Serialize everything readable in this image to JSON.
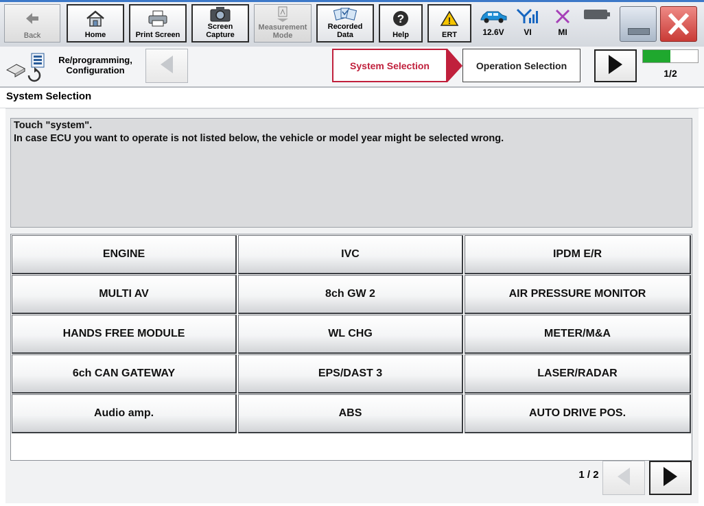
{
  "toolbar": {
    "back": "Back",
    "home": "Home",
    "print_screen": "Print Screen",
    "screen_capture_1": "Screen",
    "screen_capture_2": "Capture",
    "measurement_1": "Measurement",
    "measurement_2": "Mode",
    "recorded_1": "Recorded",
    "recorded_2": "Data",
    "help": "Help",
    "ert": "ERT"
  },
  "status": {
    "voltage": "12.6V",
    "vi": "VI",
    "mi": "MI"
  },
  "nav": {
    "mode_line1": "Re/programming,",
    "mode_line2": "Configuration",
    "breadcrumb_active": "System Selection",
    "breadcrumb_next": "Operation Selection",
    "progress_fraction": 0.5,
    "page": "1/2"
  },
  "section_title": "System Selection",
  "instructions": {
    "line1": "Touch \"system\".",
    "line2": "In case ECU you want to operate is not listed below, the vehicle or model year might be selected wrong."
  },
  "systems": [
    "ENGINE",
    "IVC",
    "IPDM E/R",
    "MULTI AV",
    "8ch GW 2",
    "AIR PRESSURE MONITOR",
    "HANDS FREE MODULE",
    "WL CHG",
    "METER/M&A",
    "6ch CAN GATEWAY",
    "EPS/DAST 3",
    "LASER/RADAR",
    "Audio amp.",
    "ABS",
    "AUTO DRIVE POS."
  ],
  "pagination": {
    "page": "1 / 2"
  },
  "colors": {
    "accent_red": "#c0203c",
    "progress_green": "#1fa82e",
    "close_red": "#d84a4a"
  }
}
